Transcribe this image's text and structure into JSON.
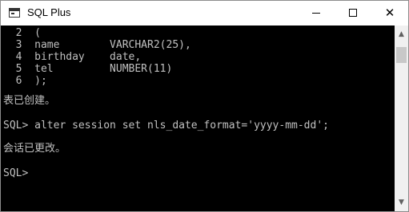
{
  "window": {
    "title": "SQL Plus",
    "icon": "console-window-icon",
    "minimize_glyph": "—",
    "close_glyph": "✕"
  },
  "console": {
    "lines": [
      "  2  (",
      "  3  name        VARCHAR2(25),",
      "  4  birthday    date,",
      "  5  tel         NUMBER(11)",
      "  6  );",
      "",
      "表已创建。",
      "",
      "SQL> alter session set nls_date_format='yyyy-mm-dd';",
      "",
      "会话已更改。",
      "",
      "SQL>"
    ]
  },
  "scrollbar": {
    "up_glyph": "▲",
    "down_glyph": "▼"
  }
}
